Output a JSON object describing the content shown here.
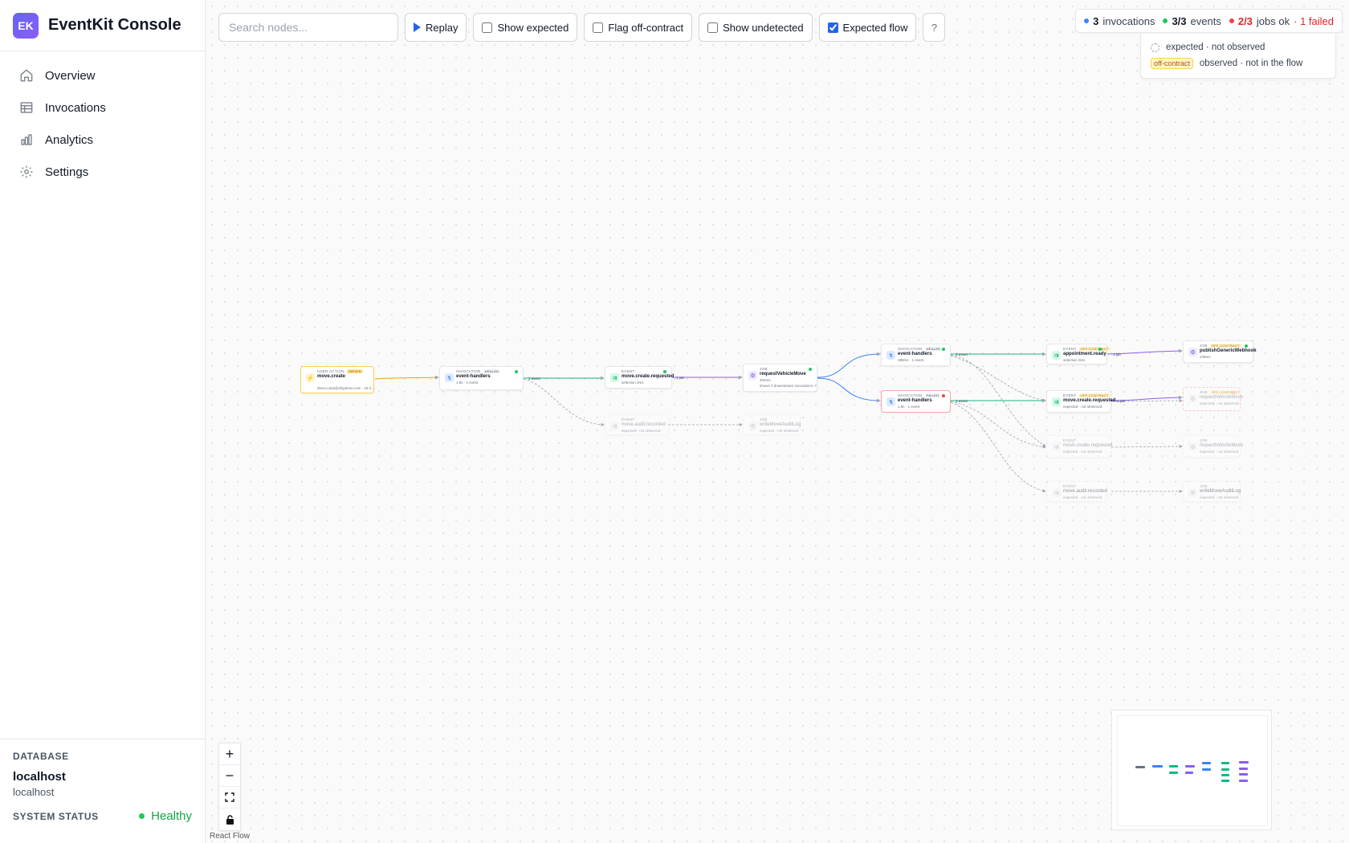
{
  "app": {
    "logo_text": "EK",
    "title": "EventKit Console"
  },
  "nav": [
    {
      "label": "Overview",
      "icon": "home-icon"
    },
    {
      "label": "Invocations",
      "icon": "table-icon"
    },
    {
      "label": "Analytics",
      "icon": "bar-chart-icon"
    },
    {
      "label": "Settings",
      "icon": "gear-icon"
    }
  ],
  "sidebar_footer": {
    "database_label": "DATABASE",
    "database_name": "localhost",
    "database_host": "localhost",
    "status_label": "SYSTEM STATUS",
    "status_value": "Healthy"
  },
  "toolbar": {
    "search_placeholder": "Search nodes...",
    "replay_label": "Replay",
    "show_expected_label": "Show expected",
    "show_expected_checked": false,
    "flag_off_contract_label": "Flag off-contract",
    "flag_off_contract_checked": false,
    "show_undetected_label": "Show undetected",
    "show_undetected_checked": false,
    "expected_flow_label": "Expected flow",
    "expected_flow_checked": true,
    "help_label": "?"
  },
  "summary": {
    "invocations_count": "3",
    "invocations_label": "invocations",
    "events_count": "3/3",
    "events_label": "events",
    "jobs_count": "2/3",
    "jobs_label": "jobs ok",
    "failed_text": "· 1 failed"
  },
  "legend": {
    "expected_text": "expected · not observed",
    "off_contract_badge": "off-contract",
    "off_contract_text": "observed · not in the flow"
  },
  "graph": {
    "nodes": [
      {
        "id": "n1",
        "kind": "USER ACTION",
        "tag": "ORIGIN",
        "title": "move.create",
        "sub": "driver.carla@shipdrive.com · 16 h...",
        "variant": "action"
      },
      {
        "id": "n2",
        "kind": "INVOCATION",
        "tag": "Healed",
        "title": "event-handlers",
        "sub": "1.8s · 1 event",
        "variant": "invocation"
      },
      {
        "id": "n3",
        "kind": "EVENT",
        "tag": "",
        "title": "move.create.requested",
        "sub": "selection 0ms",
        "variant": "event"
      },
      {
        "id": "n4",
        "kind": "JOB",
        "tag": "",
        "title": "requestVehicleMove",
        "sub": "302ms",
        "sub2": "shows 2 downstream invocations ↗",
        "variant": "job"
      },
      {
        "id": "n5",
        "kind": "EVENT",
        "tag": "",
        "title": "move.audit.recorded",
        "sub": "expected · not observed",
        "variant": "ghost"
      },
      {
        "id": "n6",
        "kind": "JOB",
        "tag": "",
        "title": "writeMoveAuditLog",
        "sub": "expected · not observed",
        "variant": "ghost"
      },
      {
        "id": "n7",
        "kind": "INVOCATION",
        "tag": "Healed",
        "title": "event-handlers",
        "sub": "388ms · 1 event",
        "variant": "invocation"
      },
      {
        "id": "n8",
        "kind": "INVOCATION",
        "tag": "Failed",
        "title": "event-handlers",
        "sub": "1.8s · 1 event",
        "variant": "failed"
      },
      {
        "id": "n9",
        "kind": "EVENT",
        "tag": "off-contract",
        "title": "appointment.ready",
        "sub": "selection 0ms",
        "variant": "event"
      },
      {
        "id": "n10",
        "kind": "JOB",
        "tag": "off-contract",
        "title": "publishGenericWebhook",
        "sub": "248ms",
        "variant": "job"
      },
      {
        "id": "n11",
        "kind": "EVENT",
        "tag": "off-contract",
        "title": "move.create.requested",
        "sub": "expected · not observed",
        "variant": "event"
      },
      {
        "id": "n12",
        "kind": "JOB",
        "tag": "off-contract",
        "title": "requestVehicleMove",
        "sub": "expected · not observed",
        "variant": "ghost"
      },
      {
        "id": "n13",
        "kind": "EVENT",
        "tag": "",
        "title": "move.create.requested",
        "sub": "expected · not observed",
        "variant": "ghost"
      },
      {
        "id": "n14",
        "kind": "JOB",
        "tag": "",
        "title": "requestVehicleMove",
        "sub": "expected · not observed",
        "variant": "ghost"
      },
      {
        "id": "n15",
        "kind": "EVENT",
        "tag": "",
        "title": "move.audit.recorded",
        "sub": "expected · not observed",
        "variant": "ghost"
      },
      {
        "id": "n16",
        "kind": "JOB",
        "tag": "",
        "title": "writeMoveAuditLog",
        "sub": "expected · not observed",
        "variant": "ghost"
      }
    ],
    "edge_labels": [
      "1 event",
      "1 job",
      "1 event",
      "1 job",
      "1 event",
      "1 job"
    ]
  },
  "controls": {
    "zoom_in": "+",
    "zoom_out": "−",
    "attribution": "React Flow"
  },
  "colors": {
    "accent": "#2563eb",
    "brand": "#6366f1",
    "event": "#10b981",
    "job": "#8b5cf6",
    "invocation": "#3b82f6",
    "action": "#f59e0b",
    "failed": "#ef4444",
    "healthy": "#22c55e"
  }
}
